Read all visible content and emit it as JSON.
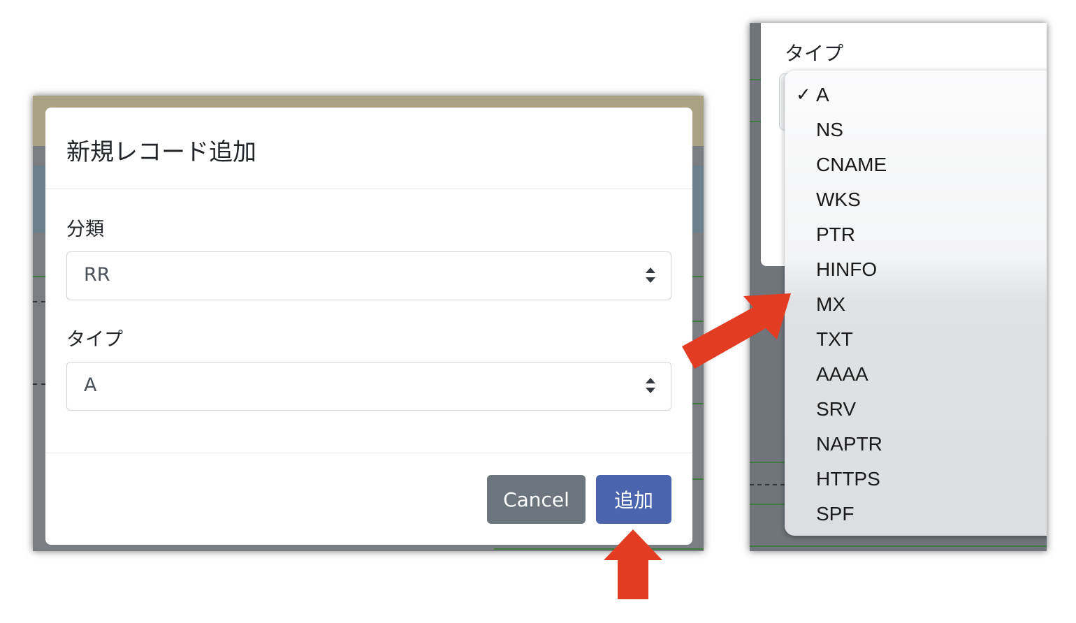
{
  "left_dialog": {
    "title": "新規レコード追加",
    "category_label": "分類",
    "category_value": "RR",
    "type_label": "タイプ",
    "type_value": "A",
    "cancel_label": "Cancel",
    "add_label": "追加"
  },
  "right_dropdown": {
    "type_label": "タイプ",
    "checkmark": "✓",
    "selected": "A",
    "options": [
      "A",
      "NS",
      "CNAME",
      "WKS",
      "PTR",
      "HINFO",
      "MX",
      "TXT",
      "AAAA",
      "SRV",
      "NAPTR",
      "HTTPS",
      "SPF"
    ]
  },
  "colors": {
    "primary_button": "#4a65ad",
    "secondary_button": "#6c757d",
    "annotation_arrow": "#e23d22"
  }
}
